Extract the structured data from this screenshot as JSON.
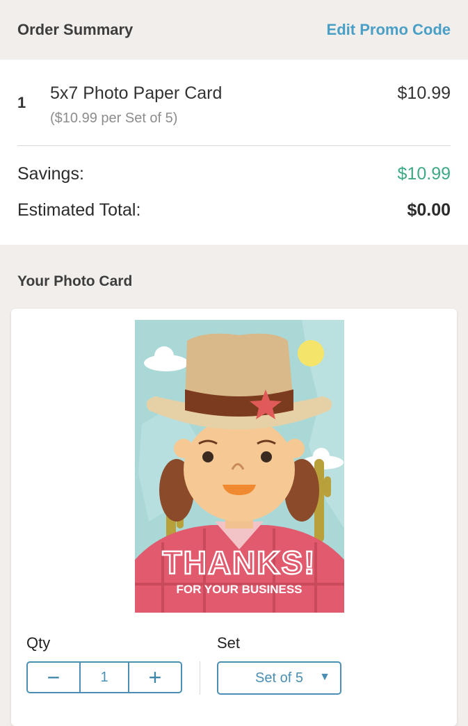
{
  "header": {
    "title": "Order Summary",
    "promo_link": "Edit Promo Code"
  },
  "line_item": {
    "qty": "1",
    "name": "5x7 Photo Paper Card",
    "unit_detail": "($10.99 per Set of 5)",
    "price": "$10.99"
  },
  "totals": {
    "savings_label": "Savings:",
    "savings_value": "$10.99",
    "total_label": "Estimated Total:",
    "total_value": "$0.00"
  },
  "photo_card": {
    "section_title": "Your Photo Card",
    "card_text_main": "THANKS!",
    "card_text_sub": "FOR YOUR BUSINESS",
    "qty_label": "Qty",
    "qty_value": "1",
    "minus_symbol": "−",
    "plus_symbol": "+",
    "set_label": "Set",
    "set_value": "Set of 5"
  },
  "colors": {
    "accent_blue": "#4a9fc6",
    "savings_green": "#3fa984",
    "background": "#f1eeeb"
  }
}
